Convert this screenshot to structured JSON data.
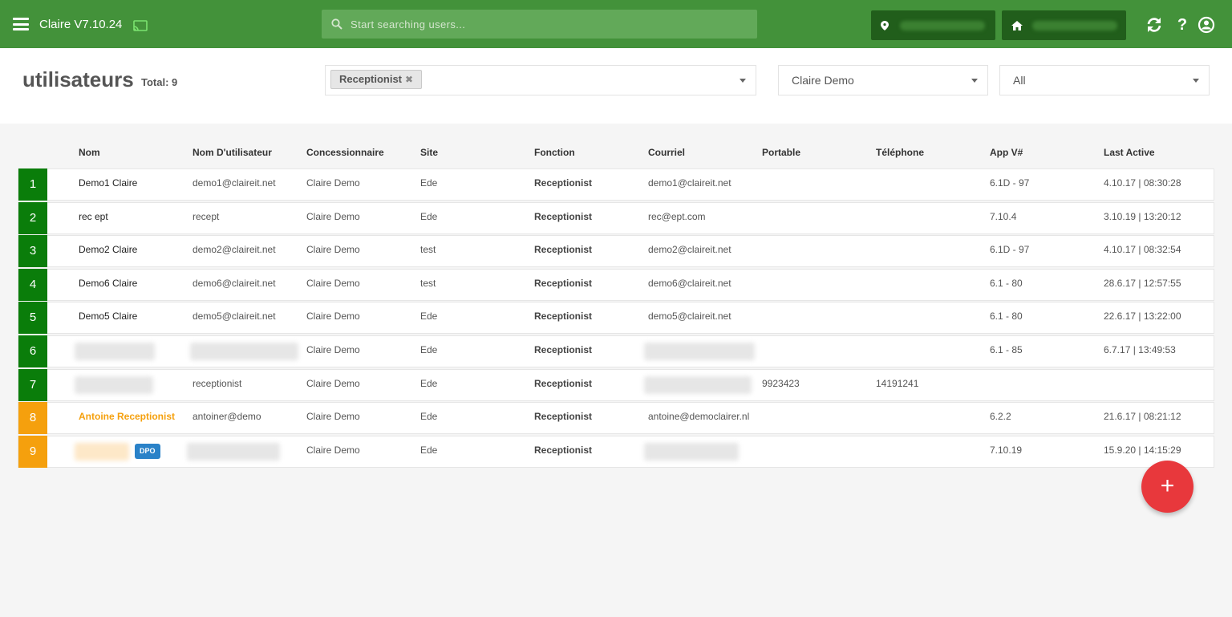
{
  "topbar": {
    "app_title": "Claire V7.10.24",
    "search_placeholder": "Start searching users...",
    "icons": [
      "menu-icon",
      "cast-icon",
      "search-icon",
      "map-pin-icon",
      "home-icon",
      "refresh-icon",
      "help-icon",
      "user-icon"
    ]
  },
  "header": {
    "title": "utilisateurs",
    "total": "Total: 9",
    "filter_tag": "Receptionist",
    "tag_remove": "✖",
    "dealer_select": "Claire Demo",
    "status_select": "All"
  },
  "table": {
    "columns": [
      "Nom",
      "Nom D'utilisateur",
      "Concessionnaire",
      "Site",
      "Fonction",
      "Courriel",
      "Portable",
      "Téléphone",
      "App V#",
      "Last Active"
    ],
    "rows": [
      {
        "num": "1",
        "status": "green",
        "name": "Demo1 Claire",
        "username": "demo1@claireit.net",
        "dealer": "Claire Demo",
        "site": "Ede",
        "function": "Receptionist",
        "email": "demo1@claireit.net",
        "mobile": "",
        "phone": "",
        "app": "6.1D - 97",
        "last_active": "4.10.17 | 08:30:28"
      },
      {
        "num": "2",
        "status": "green",
        "name": "rec ept",
        "username": "recept",
        "dealer": "Claire Demo",
        "site": "Ede",
        "function": "Receptionist",
        "email": "rec@ept.com",
        "mobile": "",
        "phone": "",
        "app": "7.10.4",
        "last_active": "3.10.19 | 13:20:12"
      },
      {
        "num": "3",
        "status": "green",
        "name": "Demo2 Claire",
        "username": "demo2@claireit.net",
        "dealer": "Claire Demo",
        "site": "test",
        "function": "Receptionist",
        "email": "demo2@claireit.net",
        "mobile": "",
        "phone": "",
        "app": "6.1D - 97",
        "last_active": "4.10.17 | 08:32:54"
      },
      {
        "num": "4",
        "status": "green",
        "name": "Demo6 Claire",
        "username": "demo6@claireit.net",
        "dealer": "Claire Demo",
        "site": "test",
        "function": "Receptionist",
        "email": "demo6@claireit.net",
        "mobile": "",
        "phone": "",
        "app": "6.1 - 80",
        "last_active": "28.6.17 | 12:57:55"
      },
      {
        "num": "5",
        "status": "green",
        "name": "Demo5 Claire",
        "username": "demo5@claireit.net",
        "dealer": "Claire Demo",
        "site": "Ede",
        "function": "Receptionist",
        "email": "demo5@claireit.net",
        "mobile": "",
        "phone": "",
        "app": "6.1 - 80",
        "last_active": "22.6.17 | 13:22:00"
      },
      {
        "num": "6",
        "status": "green",
        "name": "",
        "username": "",
        "dealer": "Claire Demo",
        "site": "Ede",
        "function": "Receptionist",
        "email": "",
        "mobile": "",
        "phone": "",
        "app": "6.1 - 85",
        "last_active": "6.7.17 | 13:49:53"
      },
      {
        "num": "7",
        "status": "green",
        "name": "",
        "username": "receptionist",
        "dealer": "Claire Demo",
        "site": "Ede",
        "function": "Receptionist",
        "email": "",
        "mobile": "9923423",
        "phone": "14191241",
        "app": "",
        "last_active": ""
      },
      {
        "num": "8",
        "status": "orange",
        "name": "Antoine Receptionist",
        "username": "antoiner@demo",
        "dealer": "Claire Demo",
        "site": "Ede",
        "function": "Receptionist",
        "email": "antoine@democlairer.nl",
        "mobile": "",
        "phone": "",
        "app": "6.2.2",
        "last_active": "21.6.17 | 08:21:12"
      },
      {
        "num": "9",
        "status": "orange",
        "name": "",
        "badge": "DPO",
        "username": "",
        "dealer": "Claire Demo",
        "site": "Ede",
        "function": "Receptionist",
        "email": "",
        "mobile": "",
        "phone": "",
        "app": "7.10.19",
        "last_active": "15.9.20 | 14:15:29"
      }
    ]
  },
  "fab": {
    "label": "+"
  },
  "colors": {
    "topbar": "#43923a",
    "green_status": "#0a7d0a",
    "orange_status": "#f5a00d",
    "fab": "#e8383c"
  }
}
